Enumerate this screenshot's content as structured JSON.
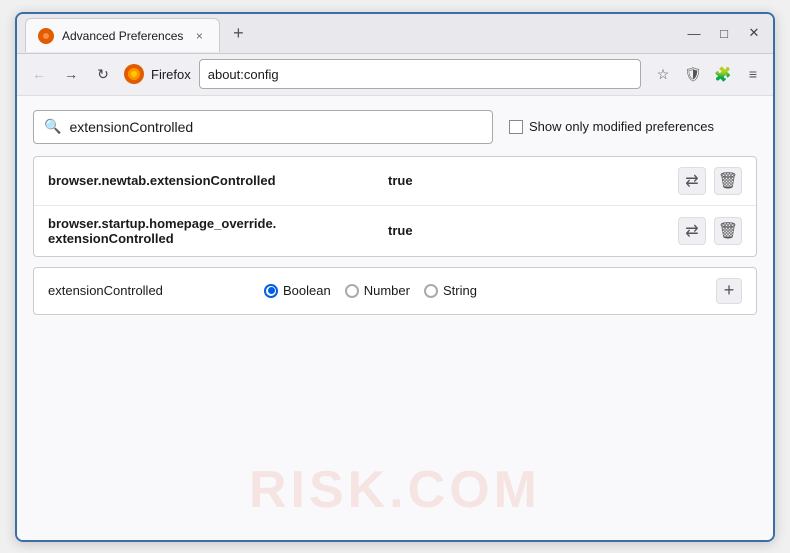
{
  "window": {
    "title": "Advanced Preferences",
    "tab_close": "×",
    "new_tab": "+",
    "minimize": "—",
    "maximize": "□",
    "close": "✕"
  },
  "nav": {
    "back": "←",
    "forward": "→",
    "reload": "↻",
    "browser_name": "Firefox",
    "address": "about:config",
    "bookmark_icon": "☆",
    "shield_icon": "🛡",
    "extension_icon": "🧩",
    "menu_icon": "≡"
  },
  "search": {
    "placeholder": "extensionControlled",
    "value": "extensionControlled",
    "show_modified_label": "Show only modified preferences"
  },
  "results": [
    {
      "name": "browser.newtab.extensionControlled",
      "value": "true"
    },
    {
      "name_line1": "browser.startup.homepage_override.",
      "name_line2": "extensionControlled",
      "value": "true"
    }
  ],
  "add_pref": {
    "name": "extensionControlled",
    "types": [
      {
        "label": "Boolean",
        "selected": true
      },
      {
        "label": "Number",
        "selected": false
      },
      {
        "label": "String",
        "selected": false
      }
    ],
    "add_btn": "+"
  },
  "watermark": "RISK.COM",
  "icons": {
    "search": "🔍",
    "toggle": "⇄",
    "delete": "🗑"
  }
}
